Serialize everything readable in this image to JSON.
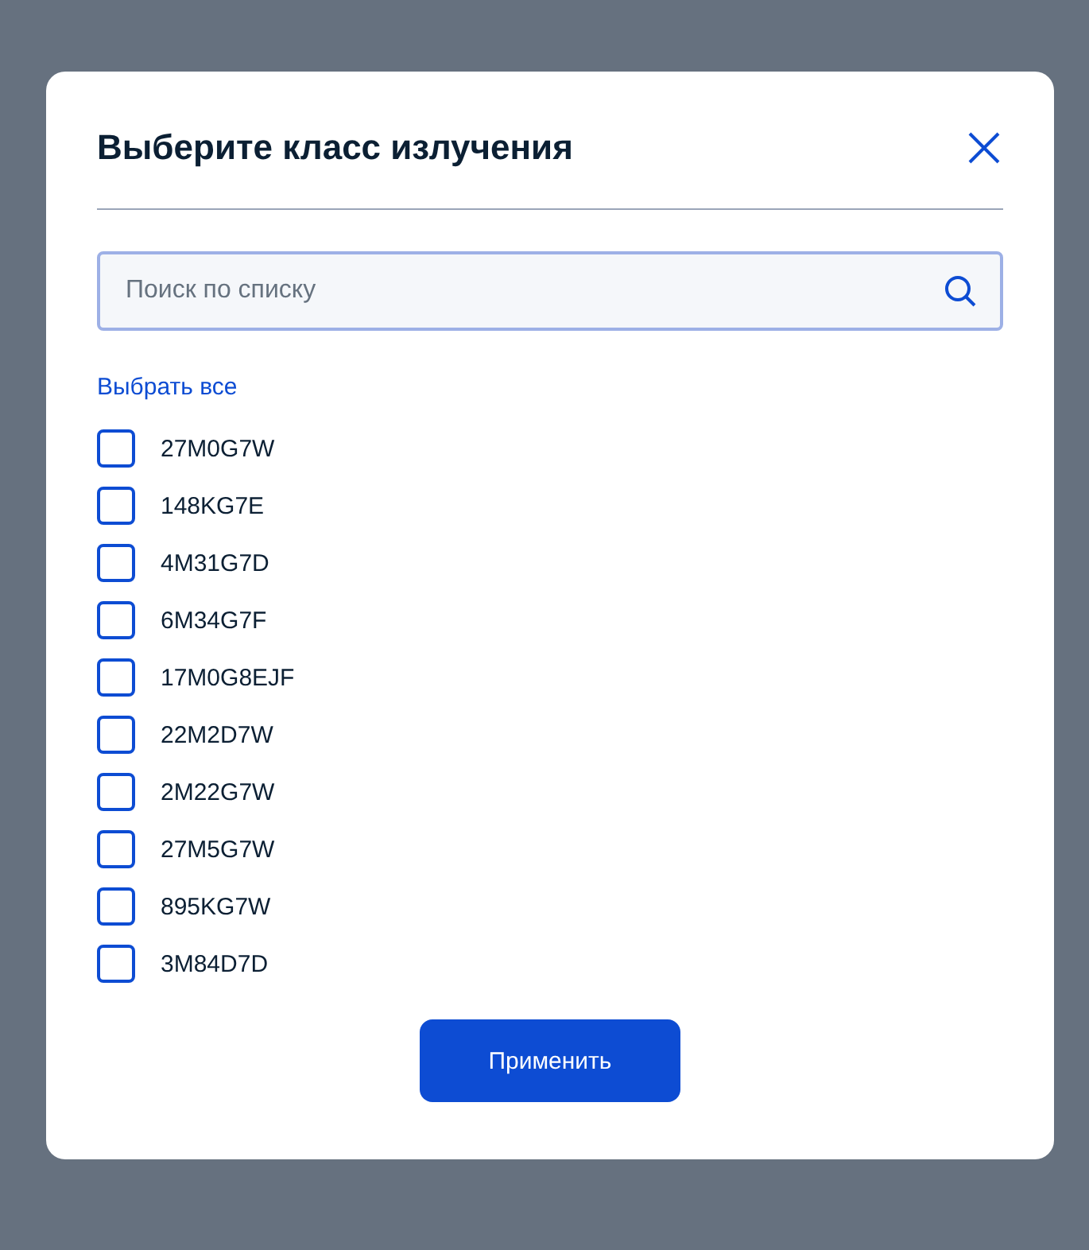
{
  "dialog": {
    "title": "Выберите класс излучения"
  },
  "search": {
    "placeholder": "Поиск по списку"
  },
  "select_all": "Выбрать все",
  "options": [
    {
      "label": "27M0G7W",
      "checked": false
    },
    {
      "label": "148KG7E",
      "checked": false
    },
    {
      "label": "4M31G7D",
      "checked": false
    },
    {
      "label": "6M34G7F",
      "checked": false
    },
    {
      "label": "17M0G8EJF",
      "checked": false
    },
    {
      "label": "22M2D7W",
      "checked": false
    },
    {
      "label": "2M22G7W",
      "checked": false
    },
    {
      "label": "27M5G7W",
      "checked": false
    },
    {
      "label": "895KG7W",
      "checked": false
    },
    {
      "label": "3M84D7D",
      "checked": false
    }
  ],
  "apply_button": "Применить"
}
